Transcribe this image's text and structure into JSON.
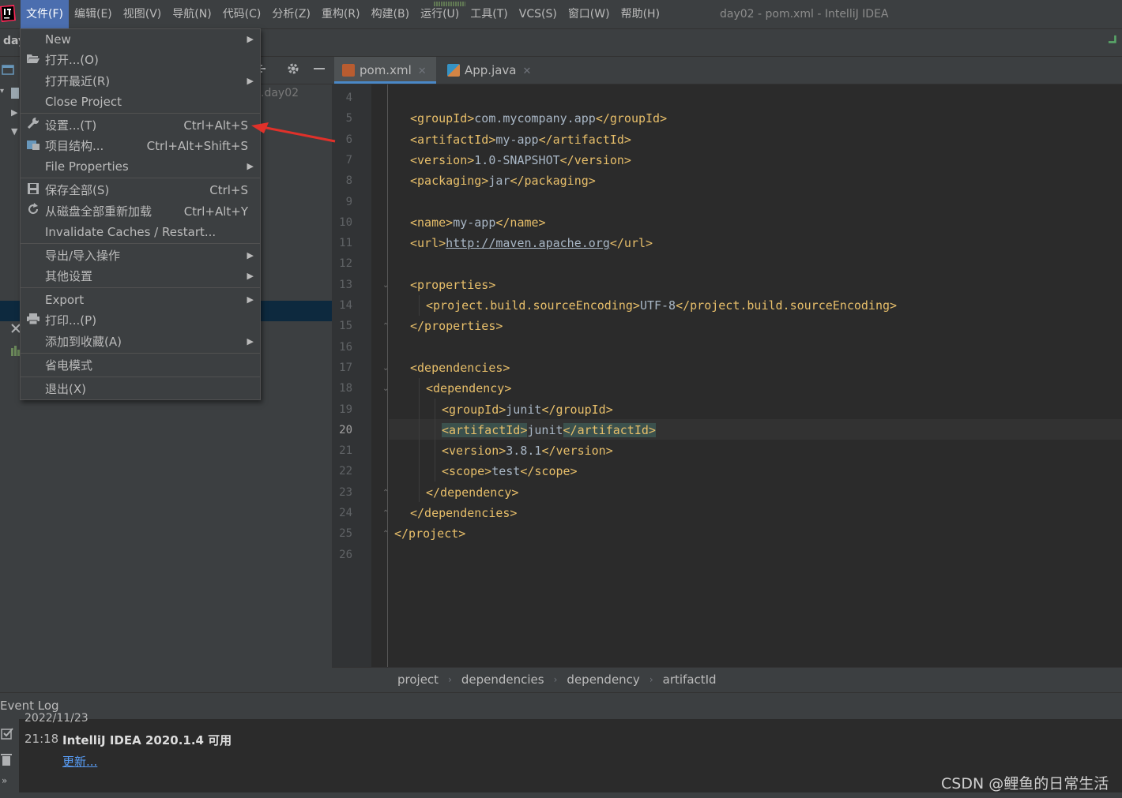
{
  "menubar": {
    "items": [
      "文件(F)",
      "编辑(E)",
      "视图(V)",
      "导航(N)",
      "代码(C)",
      "分析(Z)",
      "重构(R)",
      "构建(B)",
      "运行(U)",
      "工具(T)",
      "VCS(S)",
      "窗口(W)",
      "帮助(H)"
    ],
    "window_title": "day02 - pom.xml - IntelliJ IDEA"
  },
  "project": {
    "crumb": "day",
    "path": ".day02"
  },
  "file_menu": {
    "items": [
      {
        "label": "New",
        "shortcut": "",
        "icon": "",
        "submenu": true
      },
      {
        "label": "打开...(O)",
        "shortcut": "",
        "icon": "folder-open-icon",
        "submenu": false
      },
      {
        "label": "打开最近(R)",
        "shortcut": "",
        "icon": "",
        "submenu": true
      },
      {
        "label": "Close Project",
        "shortcut": "",
        "icon": "",
        "submenu": false
      },
      {
        "label": "设置...(T)",
        "shortcut": "Ctrl+Alt+S",
        "icon": "wrench-icon",
        "submenu": false
      },
      {
        "label": "项目结构...",
        "shortcut": "Ctrl+Alt+Shift+S",
        "icon": "project-structure-icon",
        "submenu": false
      },
      {
        "label": "File Properties",
        "shortcut": "",
        "icon": "",
        "submenu": true
      },
      {
        "label": "保存全部(S)",
        "shortcut": "Ctrl+S",
        "icon": "save-icon",
        "submenu": false
      },
      {
        "label": "从磁盘全部重新加载",
        "shortcut": "Ctrl+Alt+Y",
        "icon": "reload-icon",
        "submenu": false
      },
      {
        "label": "Invalidate Caches / Restart...",
        "shortcut": "",
        "icon": "",
        "submenu": false
      },
      {
        "label": "导出/导入操作",
        "shortcut": "",
        "icon": "",
        "submenu": true
      },
      {
        "label": "其他设置",
        "shortcut": "",
        "icon": "",
        "submenu": true
      },
      {
        "label": "Export",
        "shortcut": "",
        "icon": "",
        "submenu": true
      },
      {
        "label": "打印...(P)",
        "shortcut": "",
        "icon": "print-icon",
        "submenu": false
      },
      {
        "label": "添加到收藏(A)",
        "shortcut": "",
        "icon": "",
        "submenu": true
      },
      {
        "label": "省电模式",
        "shortcut": "",
        "icon": "",
        "submenu": false
      },
      {
        "label": "退出(X)",
        "shortcut": "",
        "icon": "",
        "submenu": false
      }
    ]
  },
  "tabs": [
    {
      "label": "pom.xml",
      "active": true
    },
    {
      "label": "App.java",
      "active": false
    }
  ],
  "editor": {
    "current_line": 20,
    "lines": [
      {
        "n": "4",
        "code": []
      },
      {
        "n": "5",
        "code": [
          [
            "tag",
            "<groupId>"
          ],
          [
            "txt",
            "com.mycompany.app"
          ],
          [
            "tag",
            "</groupId>"
          ]
        ]
      },
      {
        "n": "6",
        "code": [
          [
            "tag",
            "<artifactId>"
          ],
          [
            "txt",
            "my-app"
          ],
          [
            "tag",
            "</artifactId>"
          ]
        ]
      },
      {
        "n": "7",
        "code": [
          [
            "tag",
            "<version>"
          ],
          [
            "txt",
            "1.0-SNAPSHOT"
          ],
          [
            "tag",
            "</version>"
          ]
        ]
      },
      {
        "n": "8",
        "code": [
          [
            "tag",
            "<packaging>"
          ],
          [
            "txt",
            "jar"
          ],
          [
            "tag",
            "</packaging>"
          ]
        ]
      },
      {
        "n": "9",
        "code": []
      },
      {
        "n": "10",
        "code": [
          [
            "tag",
            "<name>"
          ],
          [
            "txt",
            "my-app"
          ],
          [
            "tag",
            "</name>"
          ]
        ]
      },
      {
        "n": "11",
        "code": [
          [
            "tag",
            "<url>"
          ],
          [
            "lnk",
            "http://maven.apache.org"
          ],
          [
            "tag",
            "</url>"
          ]
        ]
      },
      {
        "n": "12",
        "code": []
      },
      {
        "n": "13",
        "code": [
          [
            "tag",
            "<properties>"
          ]
        ]
      },
      {
        "n": "14",
        "code": [
          [
            "tag",
            "<project.build.sourceEncoding>"
          ],
          [
            "txt",
            "UTF-8"
          ],
          [
            "tag",
            "</project.build.sourceEncoding>"
          ]
        ]
      },
      {
        "n": "15",
        "code": [
          [
            "tag",
            "</properties>"
          ]
        ]
      },
      {
        "n": "16",
        "code": []
      },
      {
        "n": "17",
        "code": [
          [
            "tag",
            "<dependencies>"
          ]
        ]
      },
      {
        "n": "18",
        "code": [
          [
            "tag",
            "<dependency>"
          ]
        ]
      },
      {
        "n": "19",
        "code": [
          [
            "tag",
            "<groupId>"
          ],
          [
            "txt",
            "junit"
          ],
          [
            "tag",
            "</groupId>"
          ]
        ]
      },
      {
        "n": "20",
        "code": [
          [
            "tag hl",
            "<artifactId>"
          ],
          [
            "txt",
            "junit"
          ],
          [
            "tag hl",
            "</artifactId>"
          ]
        ]
      },
      {
        "n": "21",
        "code": [
          [
            "tag",
            "<version>"
          ],
          [
            "txt",
            "3.8.1"
          ],
          [
            "tag",
            "</version>"
          ]
        ]
      },
      {
        "n": "22",
        "code": [
          [
            "tag",
            "<scope>"
          ],
          [
            "txt",
            "test"
          ],
          [
            "tag",
            "</scope>"
          ]
        ]
      },
      {
        "n": "23",
        "code": [
          [
            "tag",
            "</dependency>"
          ]
        ]
      },
      {
        "n": "24",
        "code": [
          [
            "tag",
            "</dependencies>"
          ]
        ]
      },
      {
        "n": "25",
        "code": [
          [
            "tag",
            "</project>"
          ]
        ]
      },
      {
        "n": "26",
        "code": []
      }
    ]
  },
  "breadcrumb": [
    "project",
    "dependencies",
    "dependency",
    "artifactId"
  ],
  "event_log": {
    "title": "Event Log",
    "date": "2022/11/23",
    "time": "21:18",
    "message": "IntelliJ IDEA 2020.1.4 可用",
    "link": "更新..."
  },
  "watermark": "CSDN @鲤鱼的日常生活",
  "colors": {
    "accent": "#4b6eaf",
    "annotation": "#e0312a",
    "tag": "#e8bf6a",
    "link": "#589df6"
  }
}
